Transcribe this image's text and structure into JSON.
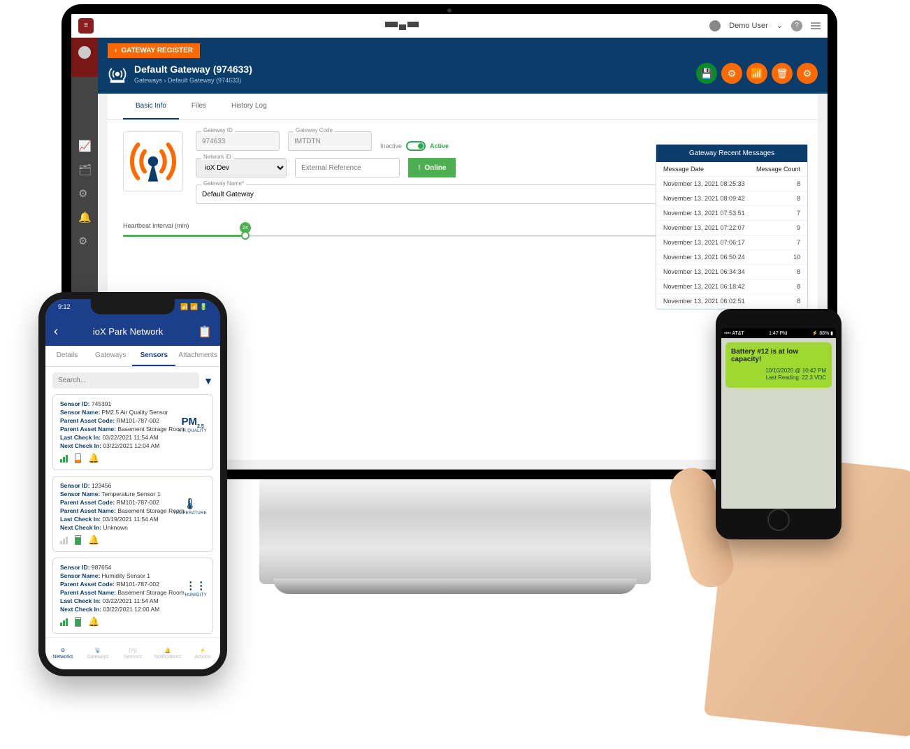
{
  "desktop": {
    "user": "Demo User",
    "back": "GATEWAY REGISTER",
    "title": "Default Gateway (974633)",
    "crumb1": "Gateways",
    "crumb2": "Default Gateway (974633)",
    "tabs": {
      "basic": "Basic Info",
      "files": "Files",
      "history": "History Log"
    },
    "form": {
      "gwid_l": "Gateway ID",
      "gwid": "974633",
      "gwcode_l": "Gateway Code",
      "gwcode": "IMTDTN",
      "inactive": "Inactive",
      "active": "Active",
      "net_l": "Network ID",
      "net": "ioX Dev",
      "ext_ph": "External Reference",
      "online": "Online",
      "name_l": "Gateway Name*",
      "name": "Default Gateway",
      "hb_l": "Heartbeat Interval (min)",
      "hb": "24"
    },
    "messages": {
      "title": "Gateway Recent Messages",
      "col1": "Message Date",
      "col2": "Message Count",
      "rows": [
        {
          "d": "November 13, 2021 08:25:33",
          "c": "8"
        },
        {
          "d": "November 13, 2021 08:09:42",
          "c": "8"
        },
        {
          "d": "November 13, 2021 07:53:51",
          "c": "7"
        },
        {
          "d": "November 13, 2021 07:22:07",
          "c": "9"
        },
        {
          "d": "November 13, 2021 07:06:17",
          "c": "7"
        },
        {
          "d": "November 13, 2021 06:50:24",
          "c": "10"
        },
        {
          "d": "November 13, 2021 06:34:34",
          "c": "8"
        },
        {
          "d": "November 13, 2021 06:18:42",
          "c": "8"
        },
        {
          "d": "November 13, 2021 06:02:51",
          "c": "8"
        }
      ]
    }
  },
  "phone_l": {
    "time": "9:12",
    "title": "ioX Park Network",
    "tabs": {
      "details": "Details",
      "gateways": "Gateways",
      "sensors": "Sensors",
      "attach": "Attachments"
    },
    "search_ph": "Search...",
    "labels": {
      "sid": "Sensor ID:",
      "sname": "Sensor Name:",
      "pac": "Parent Asset Code:",
      "pan": "Parent Asset Name:",
      "last": "Last Check In:",
      "next": "Next Check In:"
    },
    "sensors": [
      {
        "id": "745391",
        "name": "PM2.5 Air Quality Sensor",
        "pac": "RM101-787-002",
        "pan": "Basement Storage Room",
        "last": "03/22/2021 11:54 AM",
        "next": "03/22/2021 12:04 AM",
        "type_big": "PM",
        "type_sub": "2.5",
        "type_cap": "AIR QUALITY",
        "sig": "green",
        "batt": "low"
      },
      {
        "id": "123456",
        "name": "Temperature Sensor 1",
        "pac": "RM101-787-002",
        "pan": "Basement Storage Room",
        "last": "03/19/2021 11:54 AM",
        "next": "Unknown",
        "type_big": "🌡",
        "type_sub": "",
        "type_cap": "TEMPERATURE",
        "sig": "gray",
        "batt": "full"
      },
      {
        "id": "987654",
        "name": "Humidity Sensor 1",
        "pac": "RM101-787-002",
        "pan": "Basement Storage Room",
        "last": "03/22/2021 11:54 AM",
        "next": "03/22/2021 12:00 AM",
        "type_big": "⋮⋮",
        "type_sub": "",
        "type_cap": "HUMIDITY",
        "sig": "green",
        "batt": "full"
      }
    ],
    "nav": {
      "networks": "Networks",
      "gateways": "Gateways",
      "sensors": "Sensors",
      "notif": "Notifications",
      "actions": "Actions"
    }
  },
  "phone_r": {
    "carrier": "AT&T",
    "time": "1:47 PM",
    "batt": "88%",
    "sms_title": "Battery #12 is at low capacity!",
    "sms_line1": "10/10/2020 @ 10:42 PM",
    "sms_line2": "Last Reading: 22.3 VDC"
  }
}
